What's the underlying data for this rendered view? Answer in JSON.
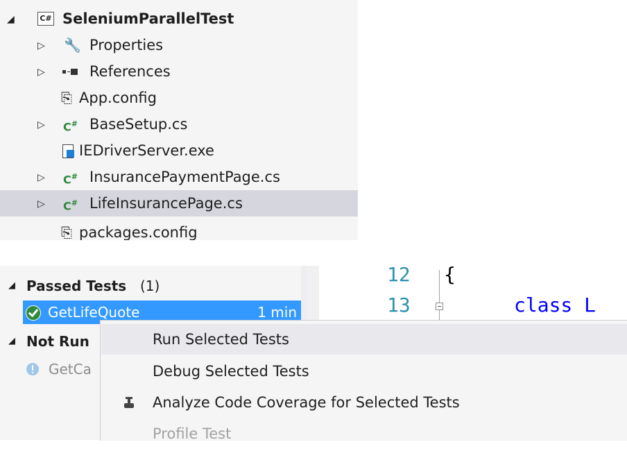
{
  "solution": {
    "project_name": "SeleniumParallelTest",
    "project_badge": "C#",
    "items": [
      {
        "label": "Properties"
      },
      {
        "label": "References"
      },
      {
        "label": "App.config"
      },
      {
        "label": "BaseSetup.cs"
      },
      {
        "label": "IEDriverServer.exe"
      },
      {
        "label": "InsurancePaymentPage.cs"
      },
      {
        "label": "LifeInsurancePage.cs"
      },
      {
        "label": "packages.config"
      }
    ],
    "cs_badge": "C#"
  },
  "test_explorer": {
    "passed_group": "Passed Tests",
    "passed_count": "(1)",
    "passed_test": "GetLifeQuote",
    "passed_duration": "1 min",
    "notrun_group": "Not Run",
    "notrun_test": "GetCa"
  },
  "code": {
    "line12_num": "12",
    "line12_text": "{",
    "line13_num": "13",
    "line13_text": "class L"
  },
  "context_menu": {
    "items": [
      {
        "label": "Run Selected Tests"
      },
      {
        "label": "Debug Selected Tests"
      },
      {
        "label": "Analyze Code Coverage for Selected Tests"
      },
      {
        "label": "Profile Test"
      }
    ]
  },
  "colors": {
    "selection_blue": "#3399ff",
    "csharp_green": "#2c8a3b",
    "keyword_blue": "#0000ff",
    "line_number_teal": "#2b91af"
  }
}
